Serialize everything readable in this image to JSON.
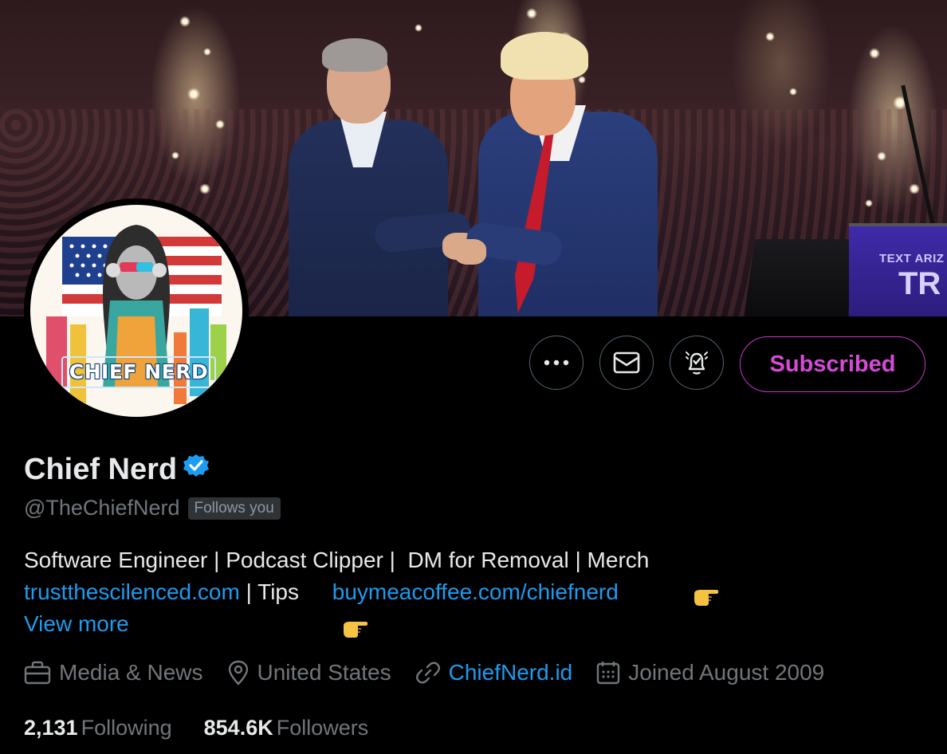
{
  "banner": {
    "sign_text_small": "TEXT ARIZ",
    "sign_text_large": "TR"
  },
  "avatar": {
    "label": "CHIEF NERD"
  },
  "actions": {
    "subscribe_label": "Subscribed",
    "more_icon": "more-icon",
    "message_icon": "envelope-icon",
    "notify_icon": "bell-check-icon"
  },
  "profile": {
    "display_name": "Chief Nerd",
    "handle": "@TheChiefNerd",
    "follows_badge": "Follows you",
    "bio_line1_text": "Software Engineer | Podcast Clipper |  DM for Removal | Merch ",
    "bio_line2_link1": "trustthescilenced.com",
    "bio_line2_text": " | Tips ",
    "bio_line2_link2": "buymeacoffee.com/chiefnerd",
    "view_more": "View more"
  },
  "meta": {
    "category": "Media & News",
    "location": "United States",
    "website": "ChiefNerd.id",
    "joined": "Joined August 2009"
  },
  "stats": {
    "following_count": "2,131",
    "following_label": "Following",
    "followers_count": "854.6K",
    "followers_label": "Followers"
  },
  "colors": {
    "background": "#000000",
    "link": "#1d9bf0",
    "subscribe_accent": "#c936cc",
    "muted_text": "#71767b",
    "verified_badge": "#1d9bf0"
  }
}
